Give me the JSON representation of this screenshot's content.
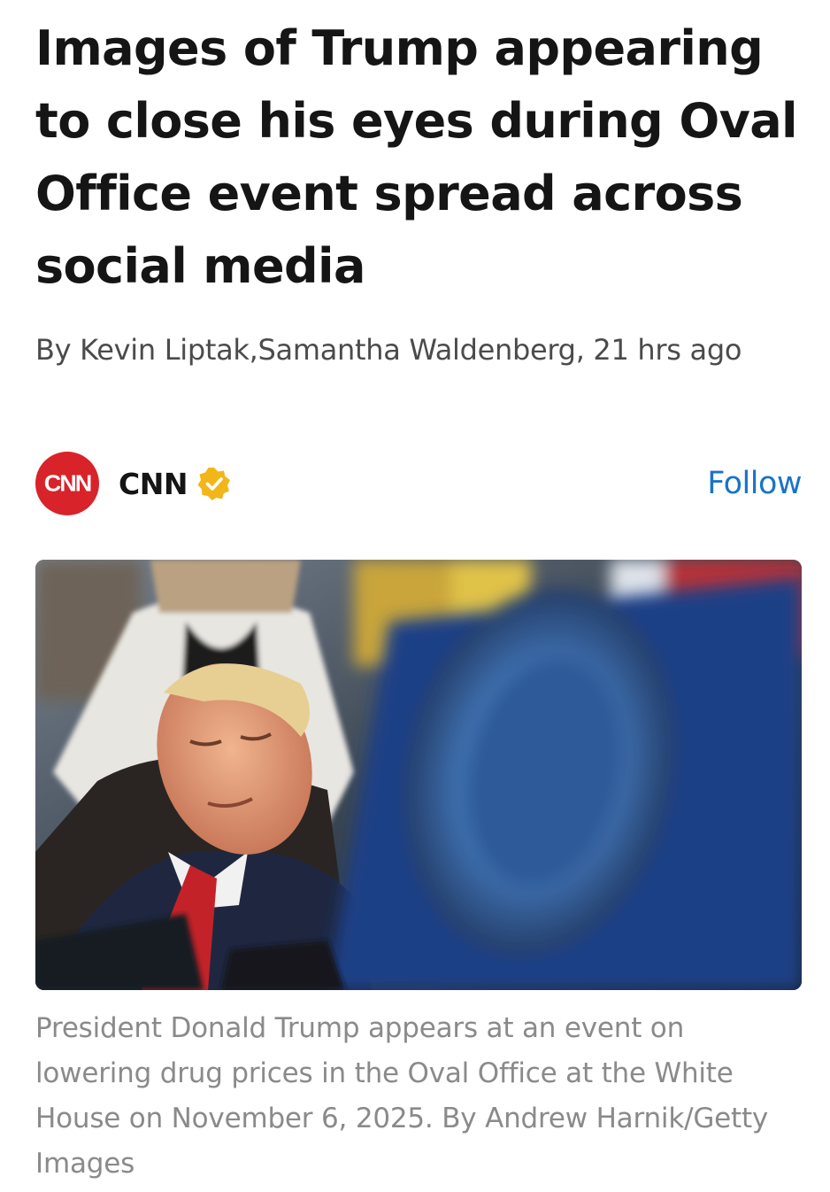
{
  "article": {
    "headline": "Images of Trump appearing to close his eyes during Oval Office event spread across social media",
    "byline": "By Kevin Liptak,Samantha Waldenberg,  21 hrs ago"
  },
  "source": {
    "logo_text": "CNN",
    "name": "CNN",
    "verified_icon": "verified-badge-icon",
    "follow_label": "Follow",
    "brand_color": "#d8232a",
    "follow_color": "#1a73c8",
    "badge_color": "#f2b619"
  },
  "image": {
    "subject": "photo-of-president-eyes-closed",
    "caption": "President Donald Trump appears at an event on lowering drug prices in the Oval Office at the White House on November 6, 2025. By Andrew Harnik/Getty Images"
  }
}
